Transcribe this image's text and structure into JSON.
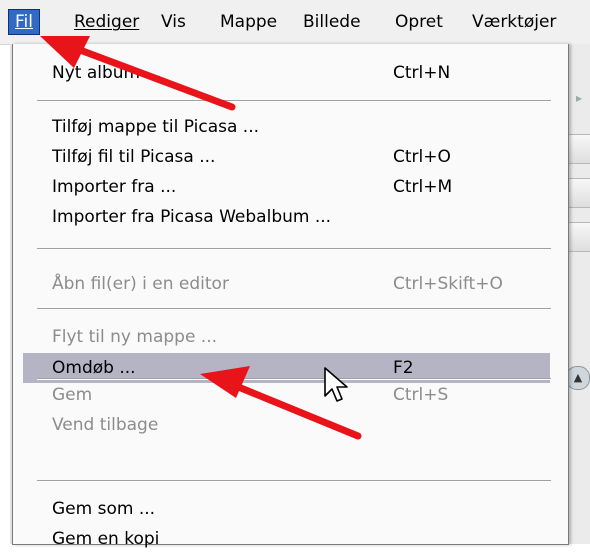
{
  "menubar": {
    "items": [
      {
        "label": "Fil",
        "mnemonic_underlined": true
      },
      {
        "label": "Rediger"
      },
      {
        "label": "Vis"
      },
      {
        "label": "Mappe"
      },
      {
        "label": "Billede"
      },
      {
        "label": "Opret"
      },
      {
        "label": "Værktøjer"
      }
    ]
  },
  "file_menu": {
    "items": [
      {
        "label": "Nyt album ...",
        "shortcut": "Ctrl+N",
        "enabled": true
      },
      {
        "label": "Tilføj mappe til Picasa ...",
        "shortcut": "",
        "enabled": true
      },
      {
        "label": "Tilføj fil til Picasa ...",
        "shortcut": "Ctrl+O",
        "enabled": true
      },
      {
        "label": "Importer fra ...",
        "shortcut": "Ctrl+M",
        "enabled": true
      },
      {
        "label": "Importer fra Picasa Webalbum ...",
        "shortcut": "",
        "enabled": true
      },
      {
        "label": "Åbn fil(er) i en editor",
        "shortcut": "Ctrl+Skift+O",
        "enabled": false
      },
      {
        "label": "Flyt til ny mappe ...",
        "shortcut": "",
        "enabled": false
      },
      {
        "label": "Omdøb ...",
        "shortcut": "F2",
        "enabled": true,
        "highlighted": true
      },
      {
        "label": "Gem",
        "shortcut": "Ctrl+S",
        "enabled": false
      },
      {
        "label": "Vend tilbage",
        "shortcut": "",
        "enabled": false
      },
      {
        "label": "Gem som ...",
        "shortcut": "",
        "enabled": true
      },
      {
        "label": "Gem en kopi",
        "shortcut": "",
        "enabled": true
      }
    ]
  },
  "annotation_color": "#e8141a",
  "highlight_color": "#b4b4c4",
  "icons": [
    "arrow-right-icon",
    "scroll-up-icon",
    "mouse-pointer-icon",
    "red-arrow-annotation"
  ]
}
